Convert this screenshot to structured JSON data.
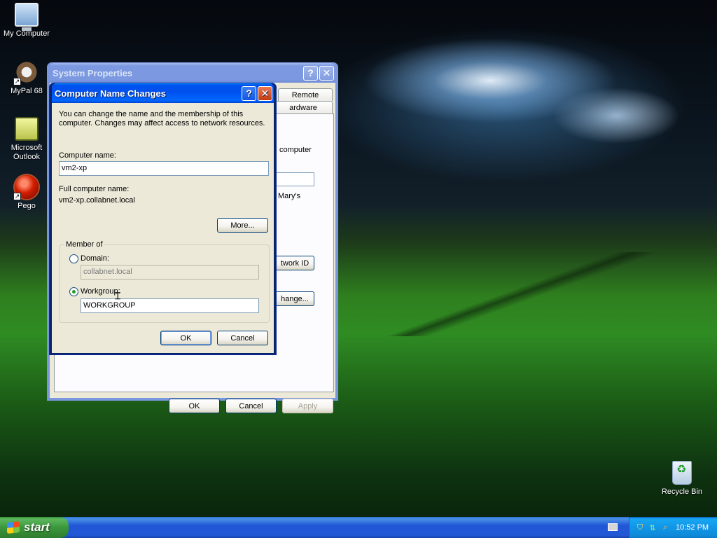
{
  "desktop": {
    "icons": [
      {
        "label": "My Computer"
      },
      {
        "label": "MyPal 68"
      },
      {
        "label": "Microsoft Outlook"
      },
      {
        "label": "Pego"
      },
      {
        "label": "Recycle Bin"
      }
    ]
  },
  "system_properties": {
    "title": "System Properties",
    "help_glyph": "?",
    "close_glyph": "✕",
    "tabs": [
      "Remote",
      "ardware"
    ],
    "partial_texts": [
      "computer",
      "Mary's"
    ],
    "network_id_button": "twork ID",
    "change_button": "hange...",
    "ok_button": "OK",
    "cancel_button": "Cancel",
    "apply_button": "Apply"
  },
  "computer_name_changes": {
    "title": "Computer Name Changes",
    "help_glyph": "?",
    "close_glyph": "✕",
    "description": "You can change the name and the membership of this computer. Changes may affect access to network resources.",
    "computer_name_label": "Computer name:",
    "computer_name_value": "vm2-xp",
    "full_name_label": "Full computer name:",
    "full_name_value": "vm2-xp.collabnet.local",
    "more_button": "More...",
    "member_of_label": "Member of",
    "domain_label": "Domain:",
    "domain_value": "collabnet.local",
    "workgroup_label": "Workgroup:",
    "workgroup_value": "WORKGROUP",
    "selected_membership": "Workgroup",
    "ok_button": "OK",
    "cancel_button": "Cancel"
  },
  "taskbar": {
    "start_label": "start",
    "clock": "10:52 PM",
    "tray_icons": [
      "keyboard-icon",
      "security-shield-icon",
      "network-icon",
      "search-icon"
    ]
  }
}
